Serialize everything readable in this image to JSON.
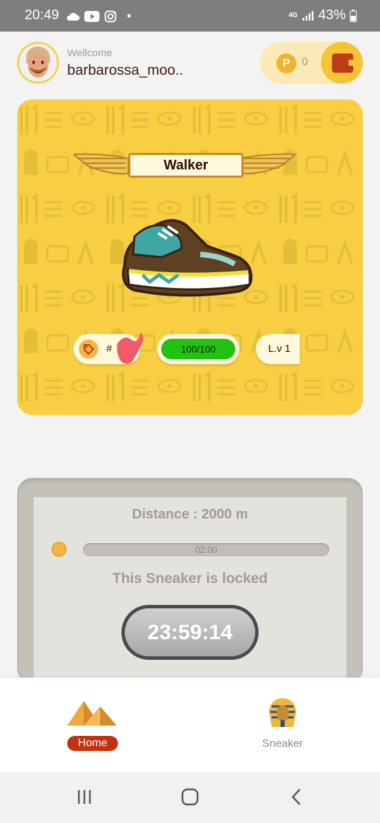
{
  "status_bar": {
    "time": "20:49",
    "dot": "•",
    "network": "4G",
    "battery": "43%"
  },
  "header": {
    "welcome": "Wellcome",
    "username": "barbarossa_moo..",
    "coin_symbol": "P",
    "coin_count": "0"
  },
  "sneaker": {
    "type": "Walker",
    "id_prefix": "#",
    "energy": "100/100",
    "energy_fraction": 1.0,
    "level": "L.v 1"
  },
  "task": {
    "distance": "Distance : 2000 m",
    "progress_time": "02:00",
    "locked_message": "This Sneaker is locked",
    "countdown": "23:59:14"
  },
  "bottom_nav": {
    "items": [
      {
        "label": "Home",
        "active": true
      },
      {
        "label": "Sneaker",
        "active": false
      }
    ]
  },
  "colors": {
    "card": "#f8cf42",
    "home_active": "#c1320f",
    "energy": "#21c212",
    "wallet": "#bf3b16"
  }
}
